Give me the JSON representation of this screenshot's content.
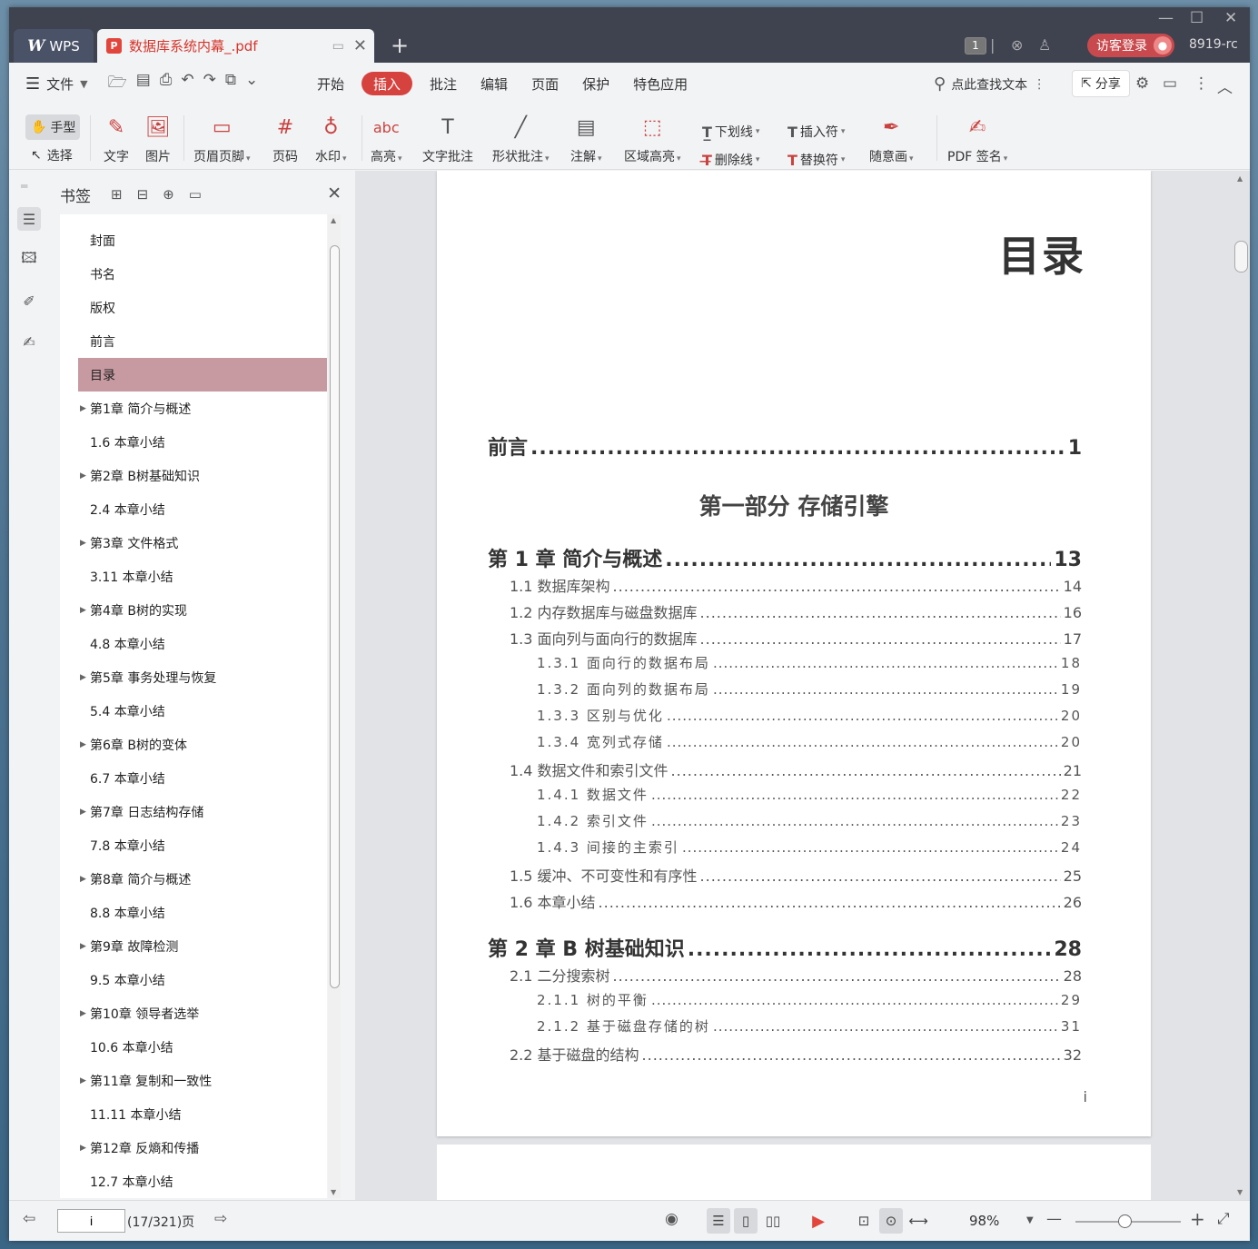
{
  "app": {
    "wps_tab": "WPS",
    "doc_tab": "数据库系统内幕_.pdf",
    "page_badge": "1",
    "login_label": "访客登录",
    "user_id": "8919-rc"
  },
  "menu": {
    "file_label": "文件",
    "items": [
      "开始",
      "插入",
      "批注",
      "编辑",
      "页面",
      "保护",
      "特色应用"
    ],
    "active": "插入",
    "search_label": "点此查找文本",
    "share_label": "分享"
  },
  "ribbon": {
    "hand_label": "手型",
    "select_label": "选择",
    "text_label": "文字",
    "image_label": "图片",
    "header_footer_label": "页眉页脚",
    "page_number_label": "页码",
    "watermark_label": "水印",
    "highlight_label": "高亮",
    "text_annot_label": "文字批注",
    "shape_annot_label": "形状批注",
    "note_label": "注解",
    "area_highlight_label": "区域高亮",
    "underline_label": "下划线",
    "strike_label": "删除线",
    "insert_mark_label": "插入符",
    "replace_mark_label": "替换符",
    "freehand_label": "随意画",
    "pdf_sign_label": "PDF 签名"
  },
  "bookmarks": {
    "title": "书签",
    "items": [
      {
        "label": "封面",
        "expandable": false
      },
      {
        "label": "书名",
        "expandable": false
      },
      {
        "label": "版权",
        "expandable": false
      },
      {
        "label": "前言",
        "expandable": false
      },
      {
        "label": "目录",
        "expandable": false,
        "selected": true
      },
      {
        "label": "第1章  简介与概述",
        "expandable": true
      },
      {
        "label": "1.6  本章小结",
        "expandable": false
      },
      {
        "label": "第2章  B树基础知识",
        "expandable": true
      },
      {
        "label": "2.4  本章小结",
        "expandable": false
      },
      {
        "label": "第3章  文件格式",
        "expandable": true
      },
      {
        "label": "3.11  本章小结",
        "expandable": false
      },
      {
        "label": "第4章  B树的实现",
        "expandable": true
      },
      {
        "label": "4.8  本章小结",
        "expandable": false
      },
      {
        "label": "第5章  事务处理与恢复",
        "expandable": true
      },
      {
        "label": "5.4  本章小结",
        "expandable": false
      },
      {
        "label": "第6章  B树的变体",
        "expandable": true
      },
      {
        "label": "6.7  本章小结",
        "expandable": false
      },
      {
        "label": "第7章  日志结构存储",
        "expandable": true
      },
      {
        "label": "7.8  本章小结",
        "expandable": false
      },
      {
        "label": "第8章  简介与概述",
        "expandable": true
      },
      {
        "label": "8.8  本章小结",
        "expandable": false
      },
      {
        "label": "第9章  故障检测",
        "expandable": true
      },
      {
        "label": "9.5  本章小结",
        "expandable": false
      },
      {
        "label": "第10章  领导者选举",
        "expandable": true
      },
      {
        "label": "10.6  本章小结",
        "expandable": false
      },
      {
        "label": "第11章  复制和一致性",
        "expandable": true
      },
      {
        "label": "11.11  本章小结",
        "expandable": false
      },
      {
        "label": "第12章  反熵和传播",
        "expandable": true
      },
      {
        "label": "12.7  本章小结",
        "expandable": false
      }
    ]
  },
  "document": {
    "title": "目录",
    "part_title": "第一部分 存储引擎",
    "page_label": "i",
    "toc": [
      {
        "text": "前言",
        "page": "1",
        "level": 0
      },
      {
        "text": "第 1 章 简介与概述",
        "page": "13",
        "level": 0
      },
      {
        "text": "1.1 数据库架构",
        "page": "14",
        "level": 1
      },
      {
        "text": "1.2 内存数据库与磁盘数据库",
        "page": "16",
        "level": 1
      },
      {
        "text": "1.3 面向列与面向行的数据库",
        "page": "17",
        "level": 1
      },
      {
        "text": "1.3.1 面向行的数据布局",
        "page": "18",
        "level": 2
      },
      {
        "text": "1.3.2 面向列的数据布局",
        "page": "19",
        "level": 2
      },
      {
        "text": "1.3.3 区别与优化",
        "page": "20",
        "level": 2
      },
      {
        "text": "1.3.4 宽列式存储",
        "page": "20",
        "level": 2
      },
      {
        "text": "1.4 数据文件和索引文件",
        "page": "21",
        "level": 1
      },
      {
        "text": "1.4.1 数据文件",
        "page": "22",
        "level": 2
      },
      {
        "text": "1.4.2 索引文件",
        "page": "23",
        "level": 2
      },
      {
        "text": "1.4.3 间接的主索引",
        "page": "24",
        "level": 2
      },
      {
        "text": "1.5 缓冲、不可变性和有序性",
        "page": "25",
        "level": 1
      },
      {
        "text": "1.6 本章小结",
        "page": "26",
        "level": 1
      },
      {
        "text": "第 2 章 B 树基础知识",
        "page": "28",
        "level": 0
      },
      {
        "text": "2.1 二分搜索树",
        "page": "28",
        "level": 1
      },
      {
        "text": "2.1.1 树的平衡",
        "page": "29",
        "level": 2
      },
      {
        "text": "2.1.2 基于磁盘存储的树",
        "page": "31",
        "level": 2
      },
      {
        "text": "2.2 基于磁盘的结构",
        "page": "32",
        "level": 1
      }
    ]
  },
  "status": {
    "page_input": "i",
    "page_info": "(17/321)页",
    "zoom": "98%"
  }
}
